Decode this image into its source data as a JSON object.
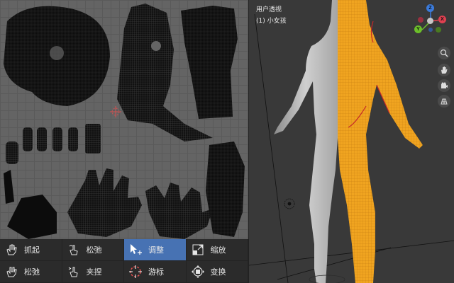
{
  "viewport": {
    "view_name": "用户透视",
    "object_name": "(1) 小女孩",
    "gizmo": {
      "z_label": "Z",
      "y_label": "Y",
      "x_label": "X"
    }
  },
  "tools": [
    {
      "label": "抓起",
      "icon": "hand-grab-icon"
    },
    {
      "label": "松弛",
      "icon": "pinch-icon"
    },
    {
      "label": "调整",
      "icon": "tweak-cursor-icon",
      "active": true
    },
    {
      "label": "缩放",
      "icon": "scale-icon"
    },
    {
      "label": "松弛",
      "icon": "pinch-icon"
    },
    {
      "label": "夹捏",
      "icon": "pinch-icon"
    },
    {
      "label": "游标",
      "icon": "cursor-target-icon"
    },
    {
      "label": "变换",
      "icon": "transform-icon"
    }
  ],
  "colors": {
    "active_tool": "#4772b3",
    "selection": "#f5a623",
    "uv_background": "#646464",
    "viewport_background": "#393939"
  }
}
